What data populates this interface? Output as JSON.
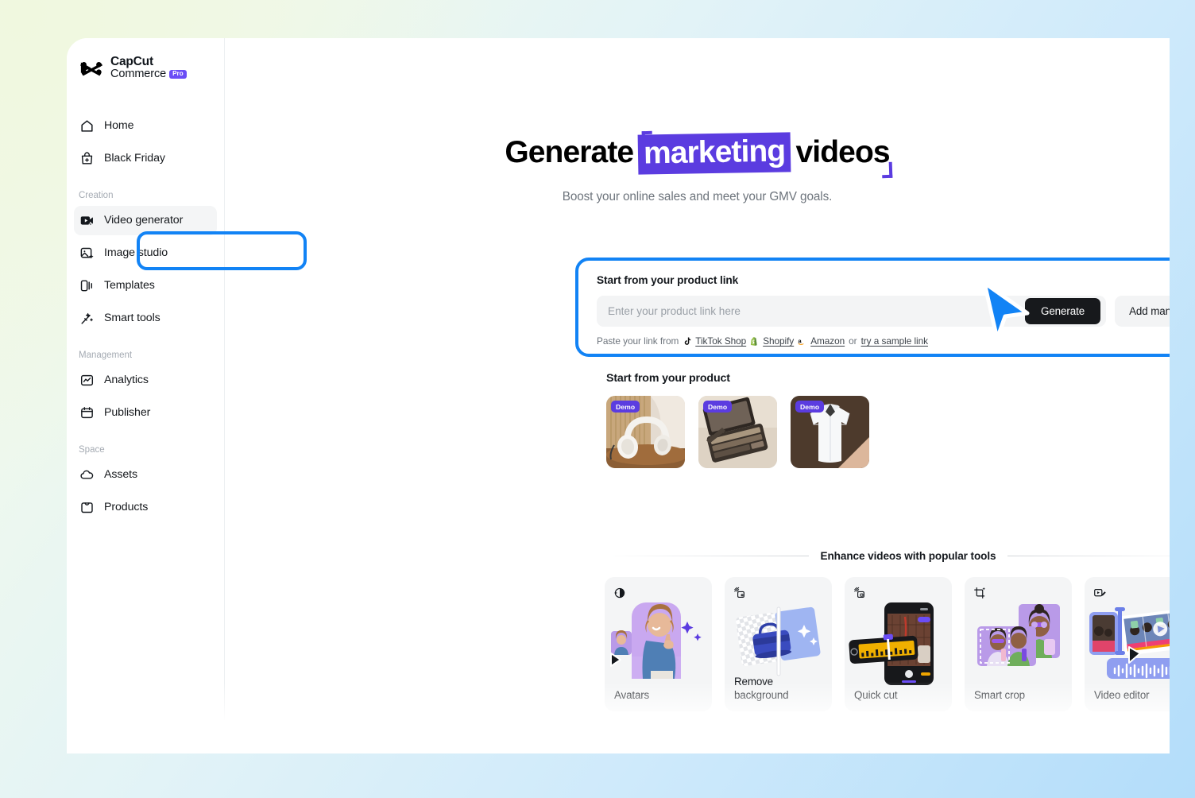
{
  "brand": {
    "name_line1": "CapCut",
    "name_line2": "Commerce",
    "pro_badge": "Pro",
    "accent_blue": "#1283f5",
    "accent_purple": "#5b3ce0",
    "highlight_green": "#7ff0a0",
    "highlight_gray": "#dfe2e8"
  },
  "sidebar": {
    "top_items": [
      {
        "label": "Home",
        "icon": "home-icon"
      },
      {
        "label": "Black Friday",
        "icon": "bag-plus-icon"
      }
    ],
    "sections": [
      {
        "label": "Creation",
        "items": [
          {
            "label": "Video generator",
            "icon": "video-sparkle-icon",
            "selected": true
          },
          {
            "label": "Image studio",
            "icon": "image-sparkle-icon",
            "selected": false
          },
          {
            "label": "Templates",
            "icon": "templates-icon",
            "selected": false
          },
          {
            "label": "Smart tools",
            "icon": "magic-wand-icon",
            "selected": false
          }
        ]
      },
      {
        "label": "Management",
        "items": [
          {
            "label": "Analytics",
            "icon": "analytics-icon",
            "selected": false
          },
          {
            "label": "Publisher",
            "icon": "calendar-icon",
            "selected": false
          }
        ]
      },
      {
        "label": "Space",
        "items": [
          {
            "label": "Assets",
            "icon": "cloud-icon",
            "selected": false
          },
          {
            "label": "Products",
            "icon": "box-icon",
            "selected": false
          }
        ]
      }
    ]
  },
  "hero": {
    "headline_part1": "Generate",
    "headline_part2": "marketing",
    "headline_part3": "videos",
    "subheadline": "Boost your online sales and meet your GMV goals."
  },
  "link_card": {
    "title": "Start from your product link",
    "input_placeholder": "Enter your product link here",
    "input_value": "",
    "generate_label": "Generate",
    "add_manually_label": "Add manually",
    "paste_prefix": "Paste your link from",
    "sources": [
      {
        "label": "TikTok Shop",
        "icon": "tiktok-icon"
      },
      {
        "label": "Shopify",
        "icon": "shopify-icon"
      },
      {
        "label": "Amazon",
        "icon": "amazon-icon"
      }
    ],
    "or_text": "or",
    "sample_link_label": "try a sample link"
  },
  "products": {
    "title": "Start from your product",
    "badge_label": "Demo",
    "items": [
      {
        "name": "white-headphones-on-wood-table"
      },
      {
        "name": "eyeshadow-palette"
      },
      {
        "name": "white-dress-shirt"
      }
    ]
  },
  "tools": {
    "title": "Enhance videos with popular tools",
    "cards": [
      {
        "label": "Avatars",
        "icon": "avatar-contrast-icon",
        "art": "avatar"
      },
      {
        "label": "Remove background",
        "icon": "image-erase-icon",
        "art": "removebg"
      },
      {
        "label": "Quick cut",
        "icon": "image-erase-icon",
        "art": "quickcut"
      },
      {
        "label": "Smart crop",
        "icon": "crop-sparkle-icon",
        "art": "smartcrop"
      },
      {
        "label": "Video editor",
        "icon": "video-edit-icon",
        "art": "videoeditor"
      }
    ]
  },
  "cursor": {
    "name": "mouse-pointer",
    "color": "#1283f5"
  }
}
